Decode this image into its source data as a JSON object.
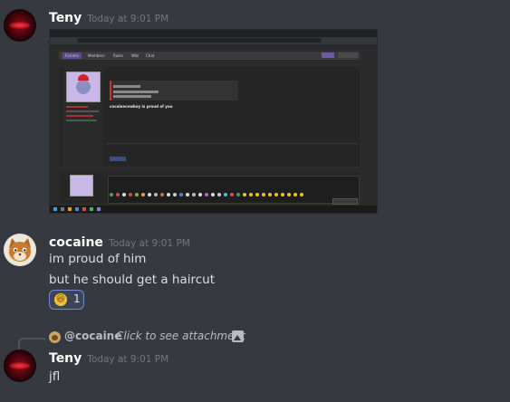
{
  "messages": [
    {
      "username": "Teny",
      "timestamp": "Today at 9:01 PM",
      "attachment": {
        "nav_tabs": [
          "Forums",
          "Members",
          "Rules",
          "Wiki",
          "Chat"
        ],
        "post_text": "cocainecowboy is proud of you"
      }
    },
    {
      "username": "cocaine",
      "timestamp": "Today at 9:01 PM",
      "lines": [
        "im proud of him",
        "but he should get a haircut"
      ],
      "reaction": {
        "emoji": "😆",
        "count": "1"
      }
    },
    {
      "reply_to": {
        "username": "@cocaine",
        "text": "Click to see attachment"
      },
      "username": "Teny",
      "timestamp": "Today at 9:01 PM",
      "text": "jfl"
    }
  ],
  "colors": {
    "background": "#36393f",
    "username": "#ffffff",
    "timestamp": "#72767d",
    "reaction_border": "#7289da"
  }
}
